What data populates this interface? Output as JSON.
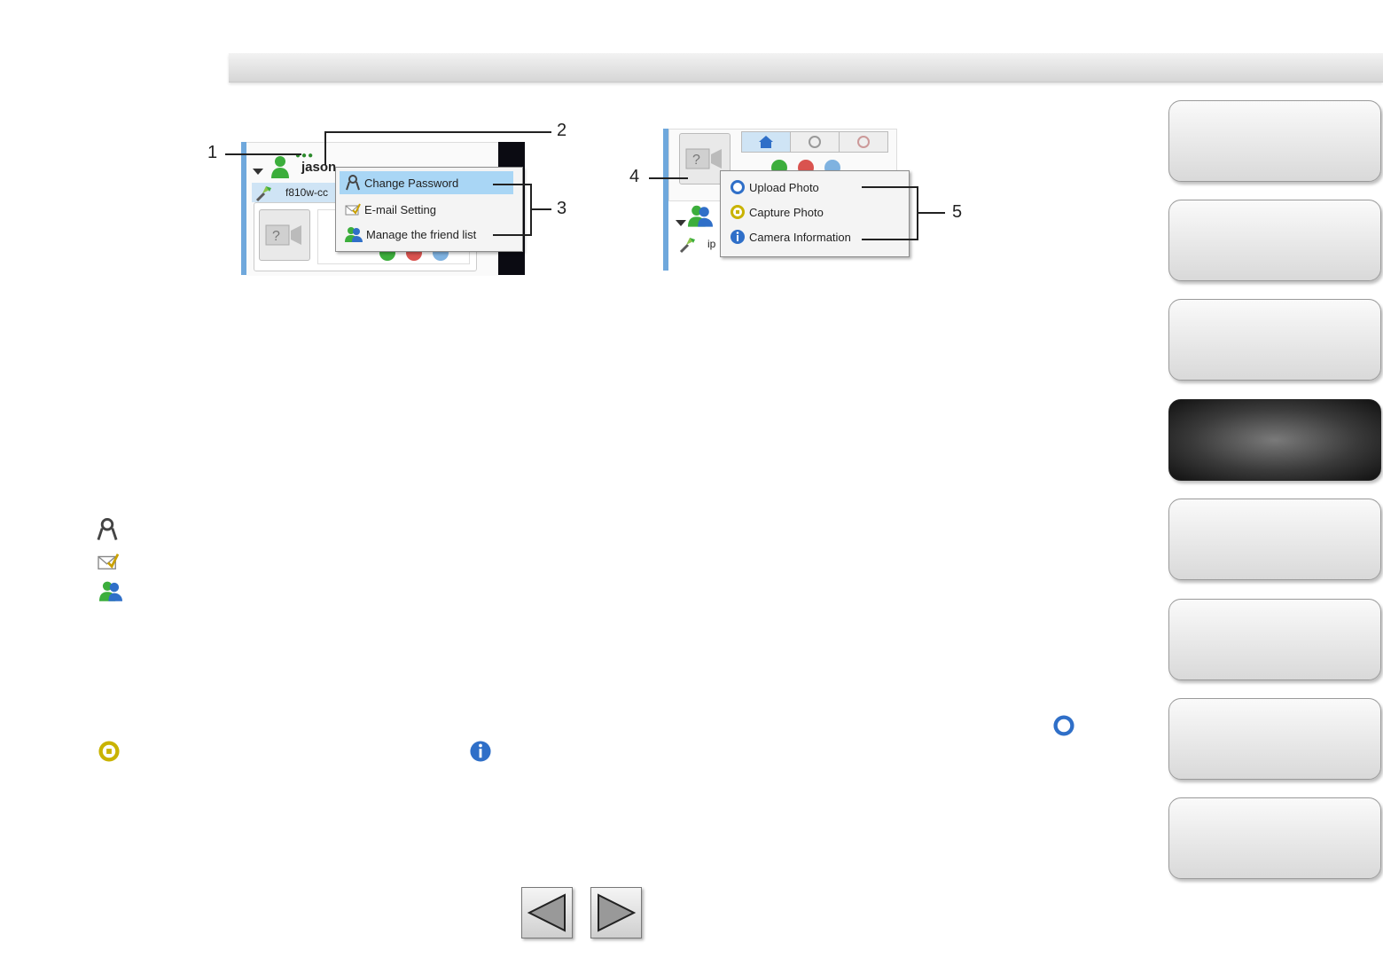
{
  "figure1": {
    "user_name": "jason",
    "camera_label": "f810w-cc",
    "menu": {
      "change_password": "Change Password",
      "email_setting": "E-mail Setting",
      "manage_friend_list": "Manage the friend list"
    },
    "callouts": {
      "c1": "1",
      "c2": "2",
      "c3": "3"
    }
  },
  "figure2": {
    "camera_label": "ip",
    "menu": {
      "upload_photo": "Upload Photo",
      "capture_photo": "Capture Photo",
      "camera_information": "Camera Information"
    },
    "callouts": {
      "c4": "4",
      "c5": "5"
    }
  },
  "nav": {
    "active_index": 3,
    "count": 8
  },
  "icons": [
    "key-icon",
    "mail-check-icon",
    "friends-icon",
    "upload-icon",
    "capture-icon",
    "info-icon"
  ],
  "colors": {
    "selected_row": "#a9d6f5",
    "sidebar_blue": "#6fa8dc",
    "green": "#3cae3c",
    "blue": "#2f6fc8",
    "yellow": "#c9b300"
  }
}
